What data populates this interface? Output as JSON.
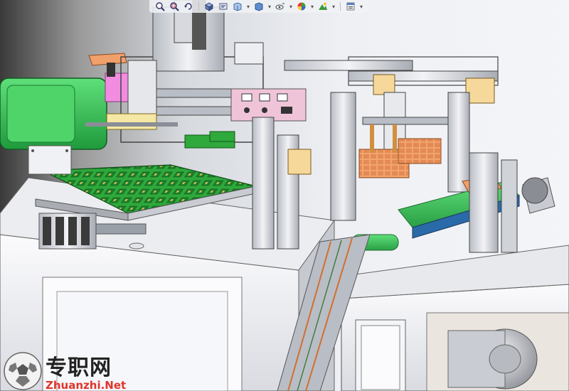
{
  "viewer": {
    "heads_up_toolbar": [
      {
        "name": "zoom-to-fit-icon",
        "has_dropdown": false
      },
      {
        "name": "zoom-to-area-icon",
        "has_dropdown": false
      },
      {
        "name": "previous-view-icon",
        "has_dropdown": false
      },
      {
        "name": "section-view-icon",
        "has_dropdown": false
      },
      {
        "name": "dynamic-annotation-icon",
        "has_dropdown": false
      },
      {
        "name": "view-orientation-icon",
        "has_dropdown": true
      },
      {
        "name": "display-style-icon",
        "has_dropdown": true
      },
      {
        "name": "hide-show-items-icon",
        "has_dropdown": true
      },
      {
        "name": "edit-appearance-icon",
        "has_dropdown": true
      },
      {
        "name": "apply-scene-icon",
        "has_dropdown": true
      },
      {
        "name": "view-settings-icon",
        "has_dropdown": true
      }
    ]
  },
  "model": {
    "description_colors": {
      "pcb_green": "#2fa83c",
      "motor_cover_green": "#3ec25a",
      "frame_white": "#f2f2f4",
      "aluminum": "#c9ccd2",
      "magenta_block": "#f28ce0",
      "orange_plate": "#f0a06a",
      "belt_green": "#3ec25a",
      "copper_plate": "#e8906a"
    }
  },
  "watermark": {
    "chinese_text": "专职网",
    "site_text": "Zhuanzhi.Net"
  }
}
